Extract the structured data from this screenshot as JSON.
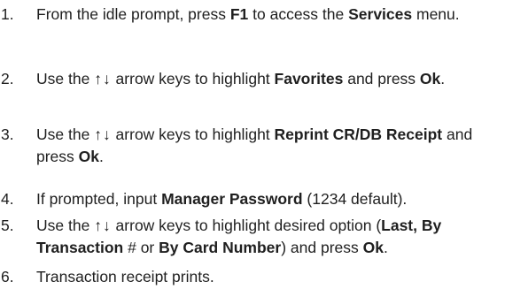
{
  "steps": [
    {
      "number": "1.",
      "parts": [
        "From the idle prompt, press ",
        "F1",
        " to access the ",
        "Services",
        " menu."
      ]
    },
    {
      "number": "2.",
      "parts": [
        "Use the ",
        "↑↓",
        " arrow keys to highlight ",
        "Favorites",
        " and press ",
        "Ok",
        "."
      ]
    },
    {
      "number": "3.",
      "parts": [
        "Use the ",
        "↑↓",
        " arrow keys to highlight ",
        "Reprint CR/DB Receipt",
        " and press ",
        "Ok",
        "."
      ]
    },
    {
      "number": "4.",
      "parts": [
        "If prompted, input ",
        "Manager Password",
        " (1234 default)."
      ]
    },
    {
      "number": "5.",
      "parts": [
        "Use the ",
        "↑↓",
        " arrow keys to highlight desired option (",
        "Last,",
        " ",
        "By Transaction",
        " # or ",
        "By Card Number",
        ") and press ",
        "Ok",
        "."
      ]
    },
    {
      "number": "6.",
      "parts": [
        "Transaction receipt prints."
      ]
    }
  ]
}
